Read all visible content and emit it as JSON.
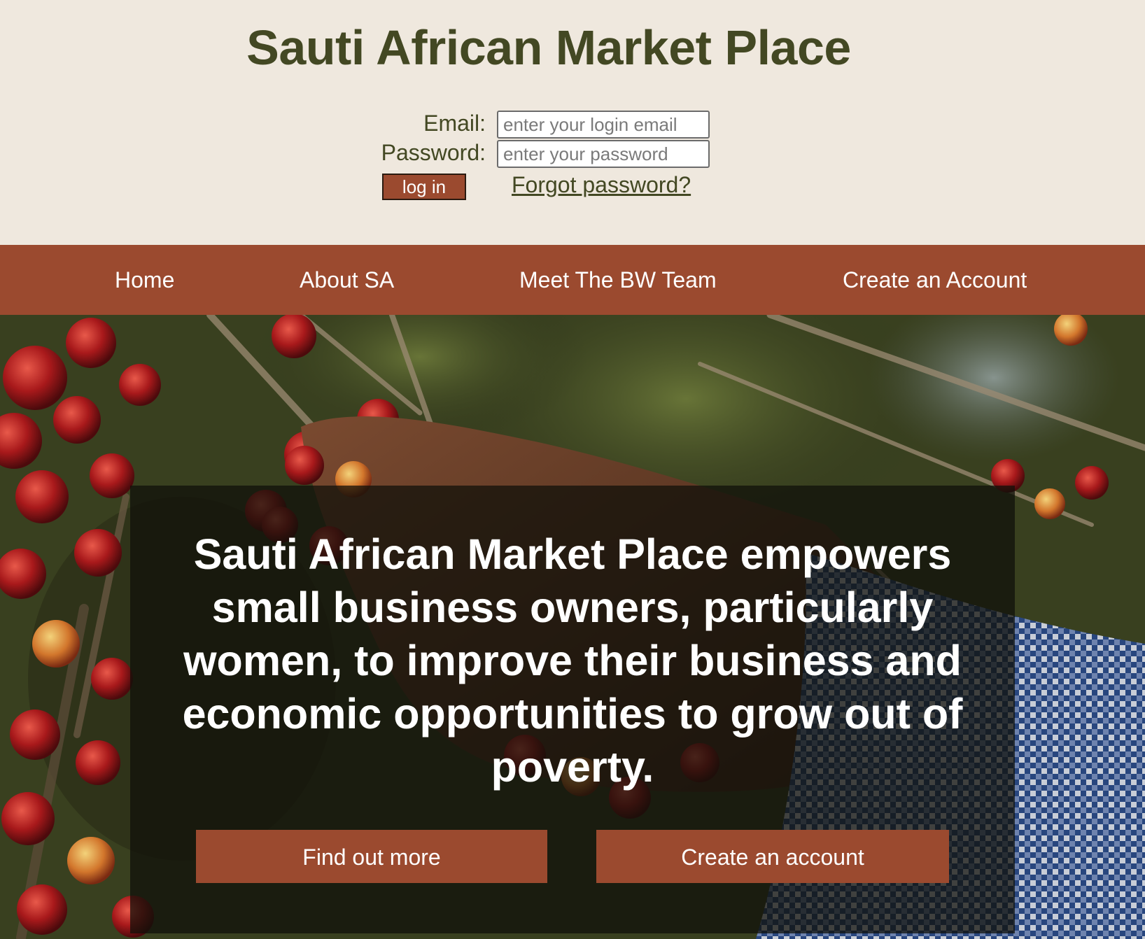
{
  "header": {
    "title": "Sauti African Market Place"
  },
  "login": {
    "email_label": "Email:",
    "email_placeholder": "enter your login email",
    "password_label": "Password:",
    "password_placeholder": "enter your password",
    "login_button": "log in",
    "forgot_link": "Forgot password?"
  },
  "nav": {
    "items": [
      {
        "label": "Home"
      },
      {
        "label": "About SA"
      },
      {
        "label": "Meet The BW Team"
      },
      {
        "label": "Create an Account"
      }
    ]
  },
  "hero": {
    "headline": "Sauti African Market Place empowers small business owners, particularly women, to improve their business and economic opportunities to grow out of poverty.",
    "primary_cta": "Find out more",
    "secondary_cta": "Create an account"
  },
  "colors": {
    "background": "#efe8de",
    "brand_rust": "#9b4a2f",
    "title_olive": "#434823"
  }
}
